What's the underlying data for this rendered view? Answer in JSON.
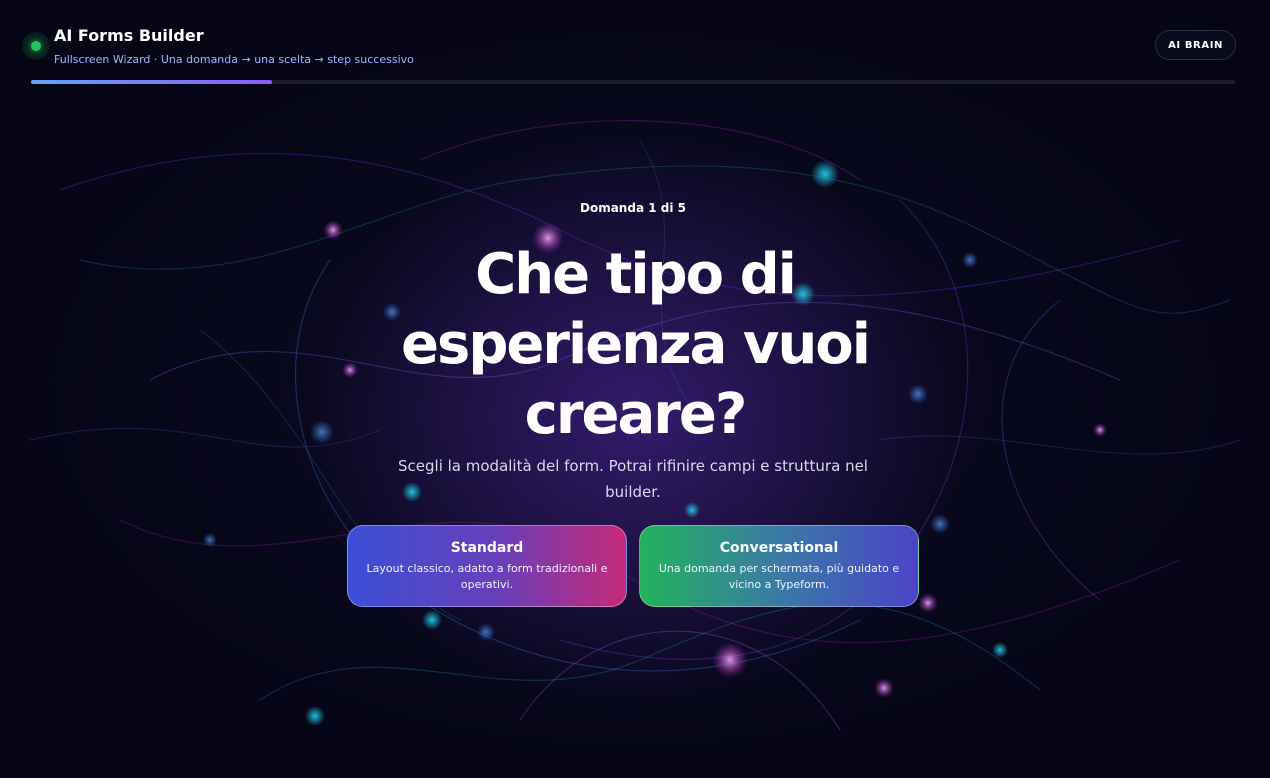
{
  "header": {
    "title": "AI Forms Builder",
    "subtitle": "Fullscreen Wizard · Una domanda → una scelta → step successivo",
    "brain_button_label": "AI BRAIN",
    "status_color": "#22c55e"
  },
  "progress": {
    "step": 1,
    "total": 5,
    "fill_fraction": 0.2,
    "gradient_colors": [
      "#60a5fa",
      "#8b5cf6"
    ]
  },
  "question": {
    "counter": "Domanda 1 di 5",
    "title": "Che tipo di esperienza vuoi creare?",
    "description": "Scegli la modalità del form. Potrai rifinire campi e struttura nel builder."
  },
  "options": [
    {
      "title": "Standard",
      "description": "Layout classico, adatto a form tradizionali e operativi.",
      "gradient_colors": [
        "#3a4fd6",
        "#6a3fb9",
        "#c62a79"
      ]
    },
    {
      "title": "Conversational",
      "description": "Una domanda per schermata, più guidato e vicino a Typeform.",
      "gradient_colors": [
        "#22b35c",
        "#3b7aa6",
        "#4b44c8"
      ]
    }
  ],
  "background": {
    "base_color": "#06061a",
    "accent_colors": [
      "#7c3aed",
      "#22d3ee",
      "#a21caf",
      "#3b82f6"
    ]
  }
}
